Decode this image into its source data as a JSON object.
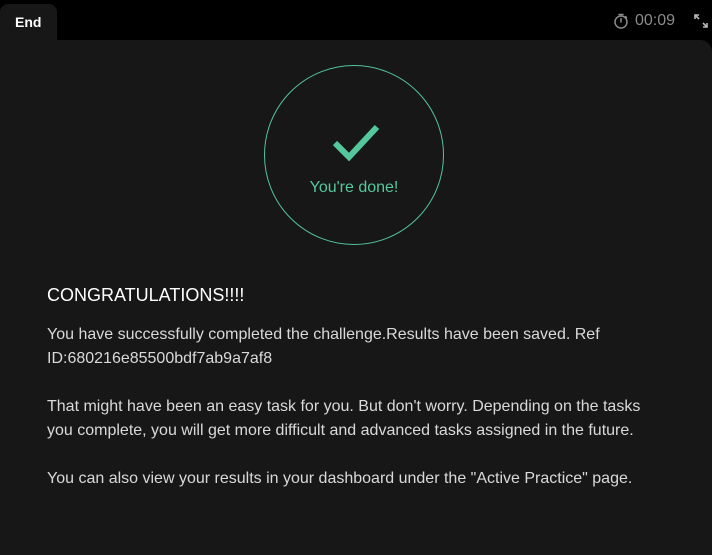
{
  "header": {
    "end_tab_label": "End",
    "timer_value": "00:09",
    "timer_icon": "stopwatch-icon",
    "expand_icon": "expand-icon"
  },
  "status": {
    "done_label": "You're done!",
    "accent_color": "#52c49a"
  },
  "message": {
    "heading": "CONGRATULATIONS!!!!",
    "paragraph_1": "You have successfully completed the challenge.Results have been saved. Ref ID:680216e85500bdf7ab9a7af8",
    "paragraph_2": "That might have been an easy task for you. But don't worry. Depending on the tasks you complete, you will get more difficult and advanced tasks assigned in the future.",
    "paragraph_3": "You can also view your results in your dashboard under the \"Active Practice\" page."
  }
}
